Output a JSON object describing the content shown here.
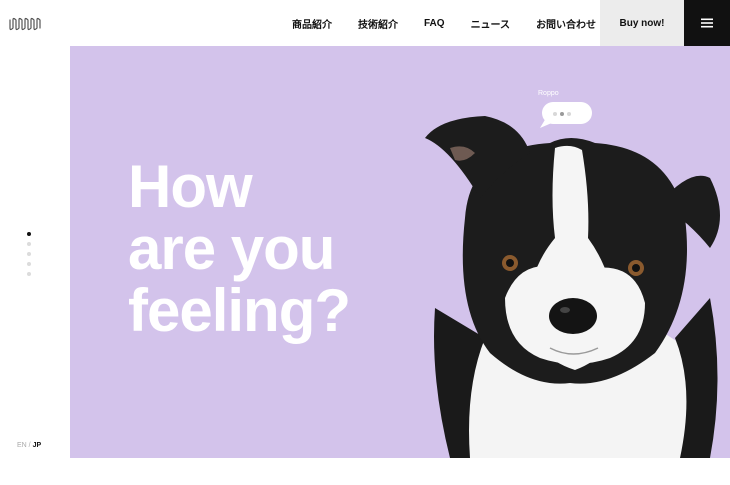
{
  "header": {
    "logo_icon": "wave-logo-icon",
    "nav": [
      "商品紹介",
      "技術紹介",
      "FAQ",
      "ニュース",
      "お問い合わせ"
    ],
    "buy_label": "Buy now!",
    "menu_icon": "hamburger-menu-icon"
  },
  "sidebar": {
    "dot_count": 5,
    "active_dot": 1,
    "lang": {
      "en": "EN",
      "separator": " / ",
      "jp": "JP",
      "active": "JP"
    }
  },
  "hero": {
    "headline": [
      "How",
      "are you",
      "feeling?"
    ],
    "background_color": "#d3c3eb",
    "image": "border-collie-dog",
    "bubble": {
      "name": "Roppo",
      "status": "typing"
    }
  }
}
